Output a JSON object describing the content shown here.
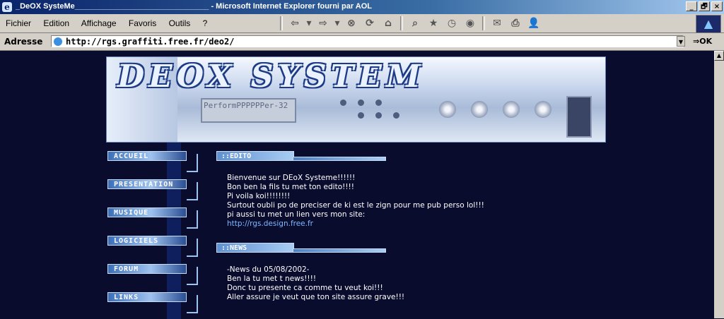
{
  "window": {
    "title": "_DeOX SysteMe_______________________________ - Microsoft Internet Explorer fourni par AOL",
    "controls": [
      "_",
      "🗗",
      "×"
    ]
  },
  "menu": {
    "items": [
      "Fichier",
      "Edition",
      "Affichage",
      "Favoris",
      "Outils",
      "?"
    ]
  },
  "toolbar": {
    "buttons": [
      {
        "icon": "back-arrow-icon",
        "glyph": "⇦"
      },
      {
        "icon": "dropdown-icon",
        "glyph": "▾"
      },
      {
        "icon": "forward-arrow-icon",
        "glyph": "⇨"
      },
      {
        "icon": "dropdown-icon",
        "glyph": "▾"
      },
      {
        "icon": "stop-icon",
        "glyph": "⊗"
      },
      {
        "icon": "refresh-icon",
        "glyph": "⟳"
      },
      {
        "icon": "home-icon",
        "glyph": "⌂"
      },
      {
        "icon": "search-icon",
        "glyph": "⌕"
      },
      {
        "icon": "favorites-icon",
        "glyph": "★"
      },
      {
        "icon": "history-icon",
        "glyph": "◷"
      },
      {
        "icon": "media-icon",
        "glyph": "◉"
      },
      {
        "icon": "mail-icon",
        "glyph": "✉"
      },
      {
        "icon": "print-icon",
        "glyph": "⎙"
      },
      {
        "icon": "messenger-icon",
        "glyph": "👤"
      }
    ]
  },
  "address": {
    "label": "Adresse",
    "url": "http://rgs.graffiti.free.fr/deo2/",
    "go_label": "OK"
  },
  "banner": {
    "logo_text": "DEOX SYSTEM",
    "lcd_text": "PerformPPPPPPer-32"
  },
  "nav": {
    "items": [
      "ACCUEIL",
      "PRESENTATION",
      "MUSIQUE",
      "LOGICIELS",
      "FORUM",
      "LINKS"
    ]
  },
  "edito": {
    "heading": "::EDITO",
    "lines": [
      "Bienvenue sur DEoX Systeme!!!!!!",
      "Bon ben la fils tu met ton edito!!!!",
      "Pi voila koi!!!!!!!!",
      "Surtout oubli po de preciser de ki est le zign pour me pub perso lol!!!",
      "pi aussi tu met un lien vers mon site:"
    ],
    "link": "http://rgs.design.free.fr"
  },
  "news": {
    "heading": "::NEWS",
    "lines": [
      "-News du 05/08/2002-",
      "Ben la tu met t news!!!!",
      "Donc tu presente ca comme tu veut koi!!!",
      "Aller assure je veut que ton site assure grave!!!"
    ]
  },
  "colors": {
    "page_background": "#0a0c2e",
    "accent": "#5f91d2",
    "link": "#7fb7ff"
  }
}
